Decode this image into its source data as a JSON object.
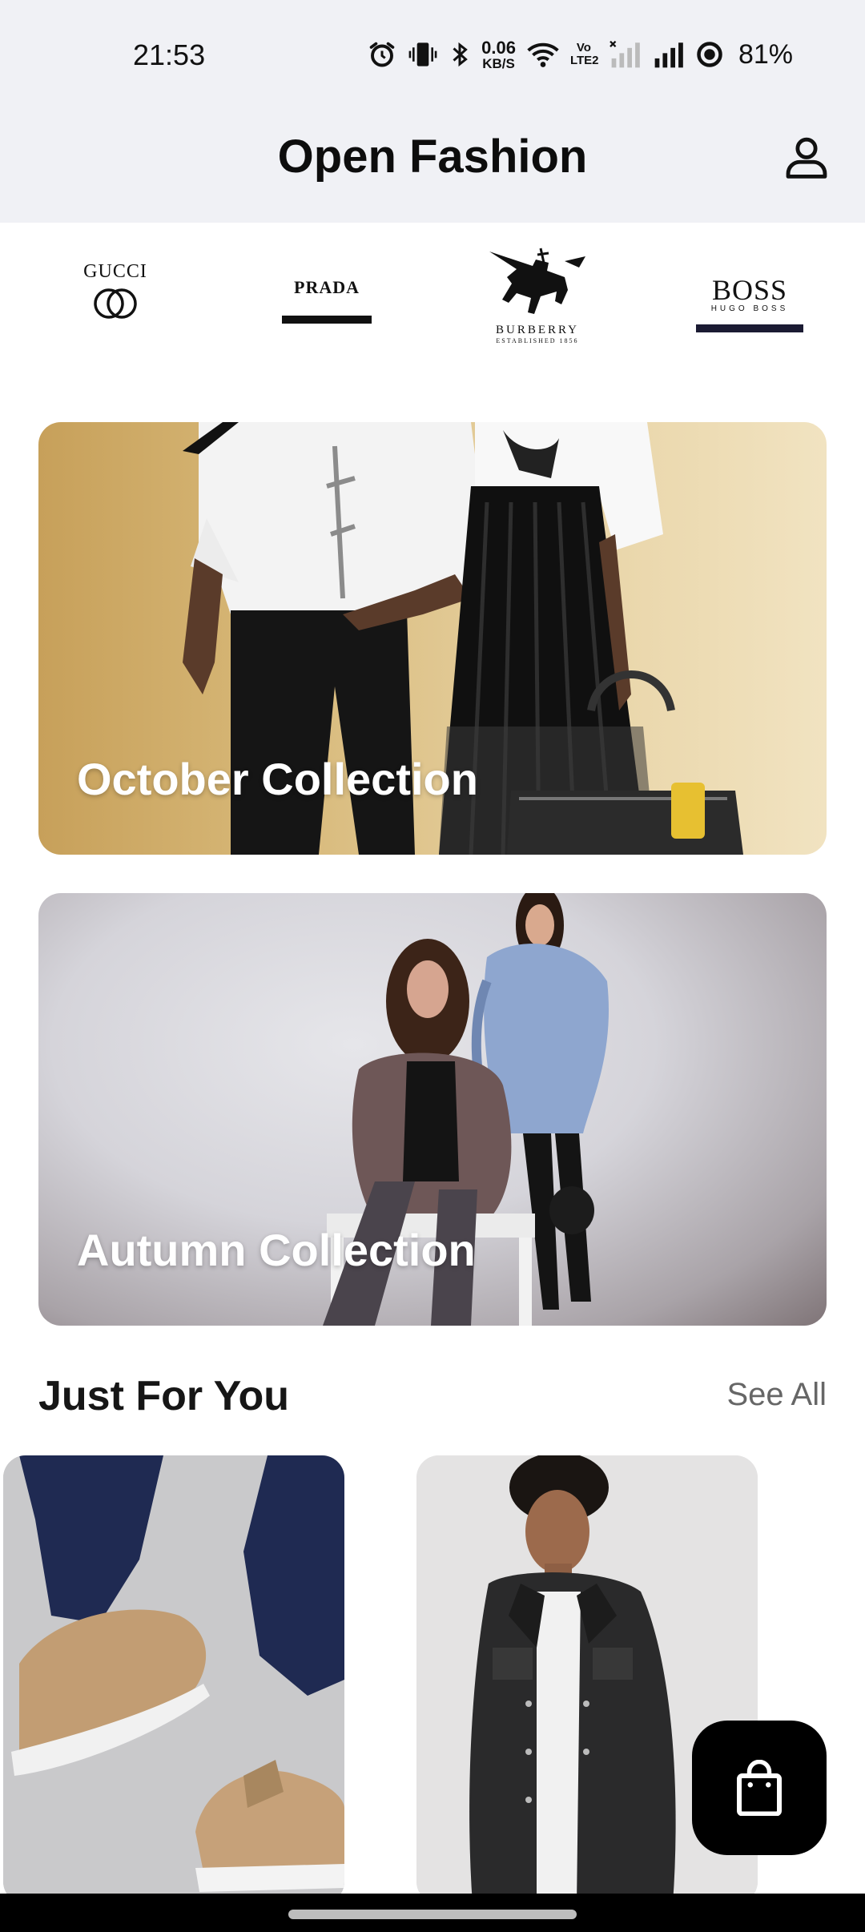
{
  "status_bar": {
    "time": "21:53",
    "net_speed_value": "0.06",
    "net_speed_unit": "KB/S",
    "volte_label": "Vo LTE2",
    "battery": "81%",
    "icons": [
      "alarm-icon",
      "vibrate-icon",
      "bluetooth-icon",
      "wifi-icon",
      "signal-off-icon",
      "signal-icon",
      "battery-icon"
    ]
  },
  "app_bar": {
    "title": "Open Fashion",
    "profile_icon": "user-icon"
  },
  "brands": {
    "gucci": "GUCCI",
    "prada": "PRADA",
    "burberry": "BURBERRY",
    "burberry_sub": "ESTABLISHED 1856",
    "boss": "BOSS",
    "boss_sub": "HUGO BOSS"
  },
  "collections": [
    {
      "title": "October Collection"
    },
    {
      "title": "Autumn Collection"
    }
  ],
  "just_for_you": {
    "title": "Just For You",
    "see_all": "See All"
  },
  "products": [
    {
      "image": "sneakers-photo"
    },
    {
      "image": "denim-jacket-photo"
    }
  ],
  "cart_button": {
    "icon": "shopping-bag-icon"
  },
  "colors": {
    "topbar_bg": "#f0f1f5",
    "fab_bg": "#000000",
    "text_primary": "#111111",
    "text_secondary": "#666666"
  }
}
